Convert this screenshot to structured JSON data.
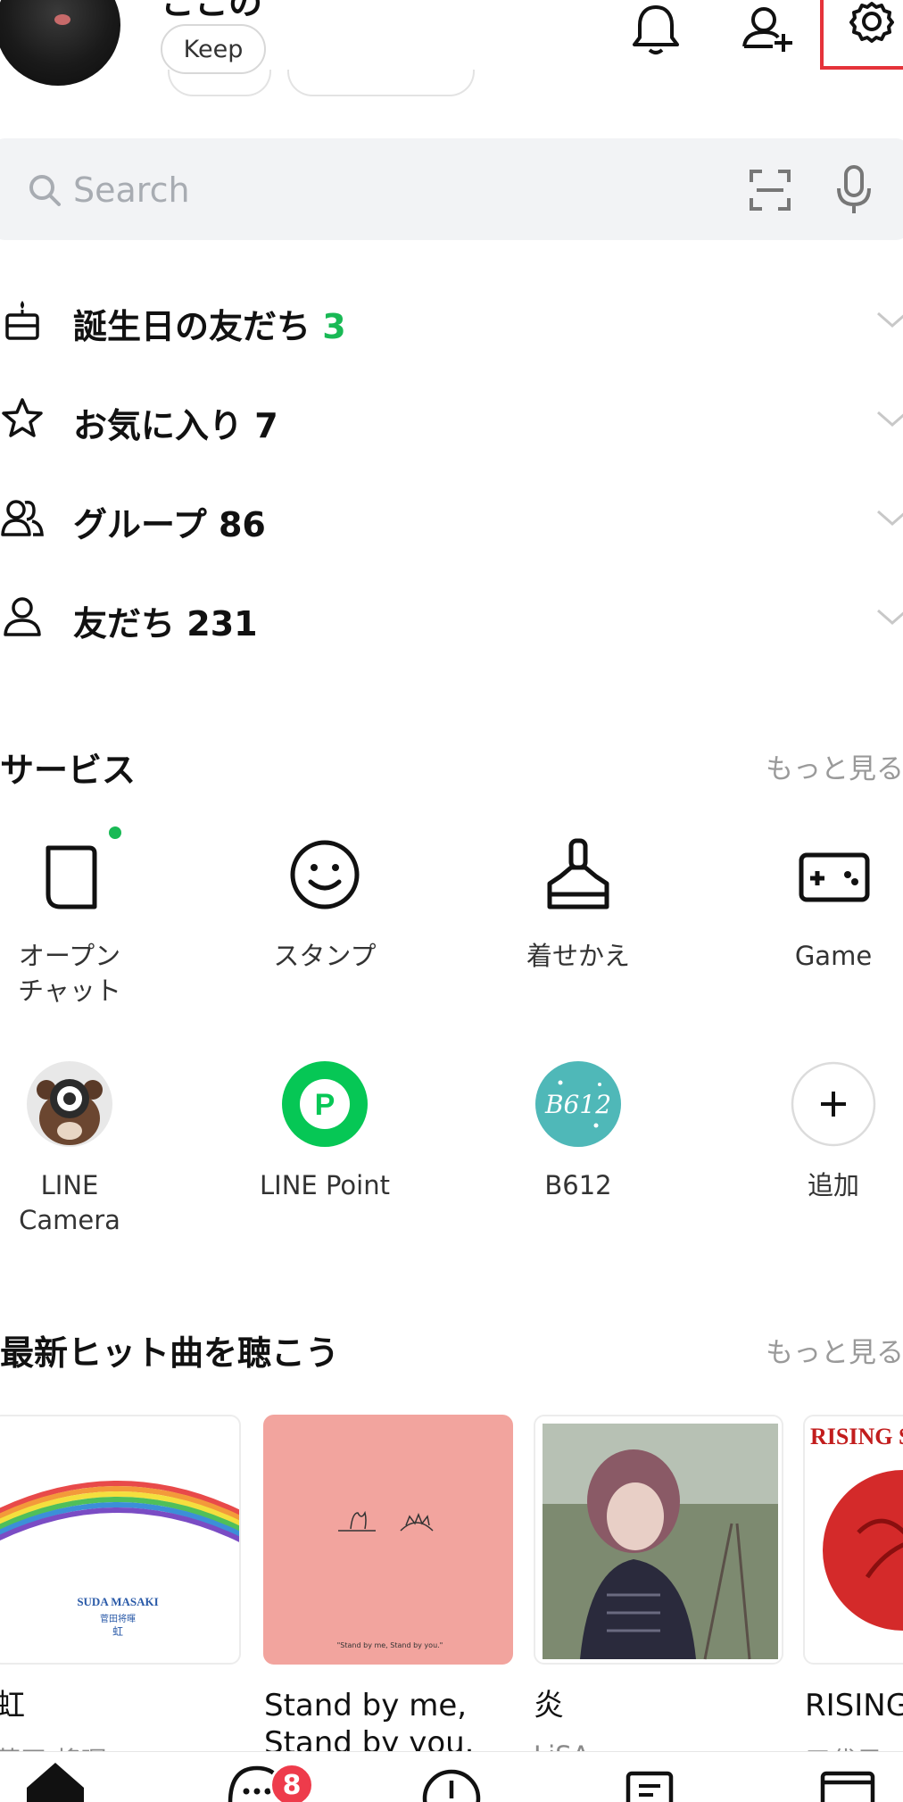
{
  "profile": {
    "name": "ここの",
    "keep_label": "Keep"
  },
  "search": {
    "placeholder": "Search"
  },
  "sections": [
    {
      "label": "誕生日の友だち",
      "count": "3",
      "icon": "birthday-cake-icon"
    },
    {
      "label": "お気に入り",
      "count": "7",
      "icon": "star-icon"
    },
    {
      "label": "グループ",
      "count": "86",
      "icon": "group-icon"
    },
    {
      "label": "友だち",
      "count": "231",
      "icon": "person-icon"
    }
  ],
  "services": {
    "title": "サービス",
    "more": "もっと見る",
    "items": [
      {
        "label": "オープン\nチャット",
        "icon": "openchat-icon"
      },
      {
        "label": "スタンプ",
        "icon": "sticker-icon"
      },
      {
        "label": "着せかえ",
        "icon": "theme-brush-icon"
      },
      {
        "label": "Game",
        "icon": "gamepad-icon"
      },
      {
        "label": "LINE\nCamera",
        "icon": "line-camera-icon"
      },
      {
        "label": "LINE Point",
        "icon": "line-point-icon"
      },
      {
        "label": "B612",
        "icon": "b612-icon"
      },
      {
        "label": "追加",
        "icon": "plus-icon"
      }
    ]
  },
  "music": {
    "title": "最新ヒット曲を聴こう",
    "more": "もっと見る",
    "albums": [
      {
        "title": "虹",
        "artist": "菅田 将暉",
        "cover_artist": "SUDA MASAKI",
        "cover_sub": "菅田将暉",
        "cover_title": "虹"
      },
      {
        "title": "Stand by me,\nStand by you.",
        "artist": "",
        "cover_text": "\"Stand by me, Stand by you.\""
      },
      {
        "title": "炎",
        "artist": "LiSA"
      },
      {
        "title": "RISING",
        "artist": "三代目",
        "cover_text": "RISING SU"
      }
    ]
  },
  "bottom_nav": {
    "chat_badge": "8"
  },
  "colors": {
    "line_green": "#19b955",
    "badge_red": "#ee3b4b",
    "highlight_red": "#e5333a"
  }
}
